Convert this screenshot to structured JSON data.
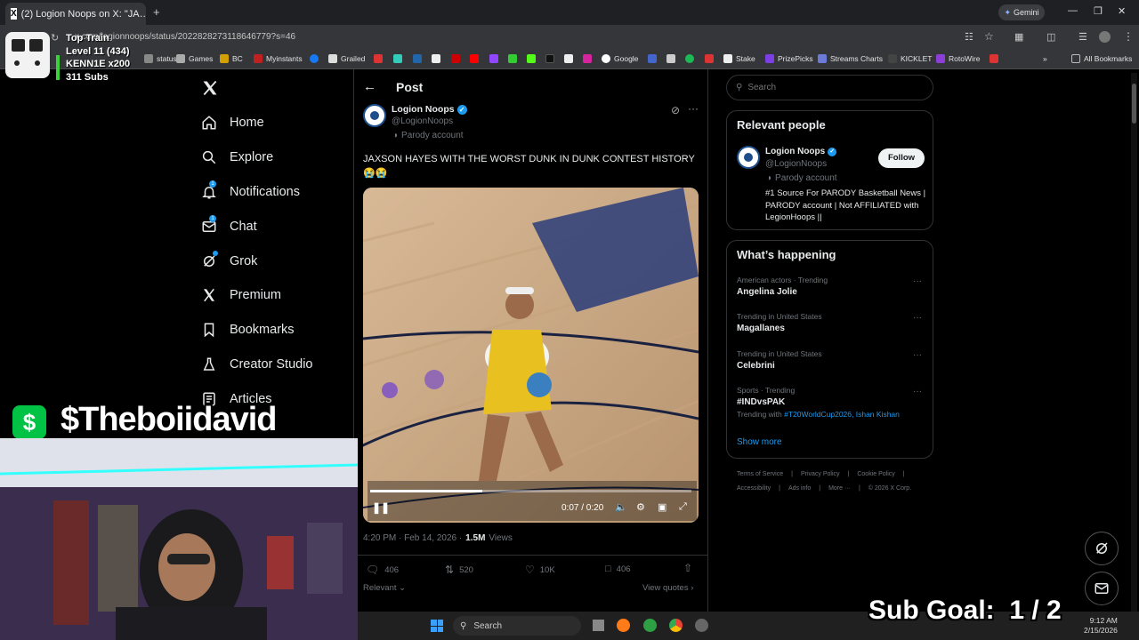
{
  "browser": {
    "tab_title": "(2) Logion Noops on X: \"JA…",
    "url": "x.com/logionnoops/status/2022828273118646779?s=46",
    "gemini_label": "Gemini",
    "bookmarks": [
      "status",
      "Games",
      "BC",
      "Myinstants",
      "Grailed",
      "Google",
      "Stake",
      "PrizePicks",
      "Streams Charts",
      "KICKLET",
      "RotoWire"
    ],
    "all_bookmarks": "All Bookmarks"
  },
  "stream_overlay": {
    "train_title": "Top Train",
    "train_level": "Level 11  (434)",
    "train_user": "KENN1E x200",
    "train_subs": "311 Subs",
    "cashtag": "$Theboiidavid",
    "sub_goal": "Sub Goal:  1 / 2"
  },
  "nav": {
    "items": [
      {
        "label": "Home"
      },
      {
        "label": "Explore"
      },
      {
        "label": "Notifications",
        "badge": "1"
      },
      {
        "label": "Chat",
        "badge": "1"
      },
      {
        "label": "Grok"
      },
      {
        "label": "Premium"
      },
      {
        "label": "Bookmarks"
      },
      {
        "label": "Creator Studio"
      },
      {
        "label": "Articles"
      }
    ]
  },
  "post": {
    "header_title": "Post",
    "author_name": "Logion Noops",
    "author_handle": "@LogionNoops",
    "parody_label": "Parody account",
    "text": "JAXSON HAYES WITH THE  WORST DUNK IN DUNK CONTEST HISTORY",
    "emoji": "😭😭",
    "video_time": "0:07 / 0:20",
    "video_progress": 0.35,
    "timestamp": "4:20 PM · Feb 14, 2026 ·",
    "views_count": "1.5M",
    "views_label": "Views",
    "replies": "406",
    "reposts": "520",
    "likes": "10K",
    "bookmarks": "406",
    "sort_label": "Relevant",
    "view_quotes": "View quotes"
  },
  "search": {
    "placeholder": "Search"
  },
  "relevant_people": {
    "title": "Relevant people",
    "name": "Logion Noops",
    "handle": "@LogionNoops",
    "parody": "Parody account",
    "follow_label": "Follow",
    "bio": "#1 Source For PARODY Basketball News | PARODY account | Not AFFILIATED with LegionHoops ||"
  },
  "whats_happening": {
    "title": "What’s happening",
    "trends": [
      {
        "meta": "American actors · Trending",
        "title": "Angelina Jolie"
      },
      {
        "meta": "Trending in United States",
        "title": "Magallanes"
      },
      {
        "meta": "Trending in United States",
        "title": "Celebrini"
      },
      {
        "meta": "Sports · Trending",
        "title": "#INDvsPAK",
        "sub_prefix": "Trending with",
        "sub_links": "#T20WorldCup2026, Ishan Kishan"
      }
    ],
    "show_more": "Show more"
  },
  "footer_links": {
    "row1": [
      "Terms of Service",
      "Privacy Policy",
      "Cookie Policy"
    ],
    "row2": [
      "Accessibility",
      "Ads info",
      "More ···",
      "© 2026 X Corp."
    ]
  },
  "taskbar": {
    "search_label": "Search",
    "time": "9:12 AM",
    "date": "2/15/2026"
  },
  "colors": {
    "accent": "#1d9bf0",
    "background": "#000000",
    "border": "#2f3336",
    "muted": "#71767b"
  }
}
